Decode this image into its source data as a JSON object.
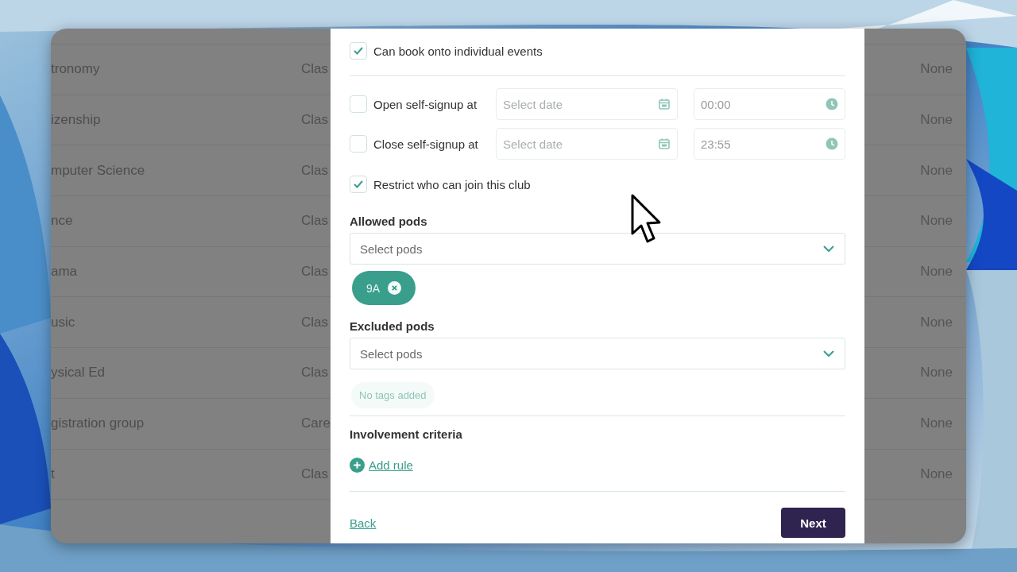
{
  "table": {
    "rows": [
      {
        "column_1": "tronomy",
        "column_2": "Clas",
        "column_3": "None"
      },
      {
        "column_1": "izenship",
        "column_2": "Clas",
        "column_3": "None"
      },
      {
        "column_1": "mputer Science",
        "column_2": "Clas",
        "column_3": "None"
      },
      {
        "column_1": "nce",
        "column_2": "Clas",
        "column_3": "None"
      },
      {
        "column_1": "ama",
        "column_2": "Clas",
        "column_3": "None"
      },
      {
        "column_1": "usic",
        "column_2": "Clas",
        "column_3": "None"
      },
      {
        "column_1": "ysical Ed",
        "column_2": "Clas",
        "column_3": "None"
      },
      {
        "column_1": "gistration group",
        "column_2": "Care",
        "column_3": "None"
      },
      {
        "column_1": "t",
        "column_2": "Clas",
        "column_3": "None"
      }
    ]
  },
  "modal": {
    "booking": {
      "label": "Can book onto individual events",
      "checked": true
    },
    "schedule": [
      {
        "label": "Open self-signup at",
        "checked": false,
        "date_placeholder": "Select date",
        "time": "00:00"
      },
      {
        "label": "Close self-signup at",
        "checked": false,
        "date_placeholder": "Select date",
        "time": "23:55"
      }
    ],
    "restrict": {
      "label": "Restrict who can join this club",
      "checked": true
    },
    "allowed_pods": {
      "label": "Allowed pods",
      "placeholder": "Select pods",
      "tags": [
        {
          "label": "9A"
        }
      ]
    },
    "excluded_pods": {
      "label": "Excluded pods",
      "placeholder": "Select pods",
      "empty_text": "No tags added"
    },
    "involvement": {
      "title": "Involvement criteria",
      "add_link": "Add rule"
    },
    "footer": {
      "back": "Back",
      "next": "Next"
    }
  }
}
